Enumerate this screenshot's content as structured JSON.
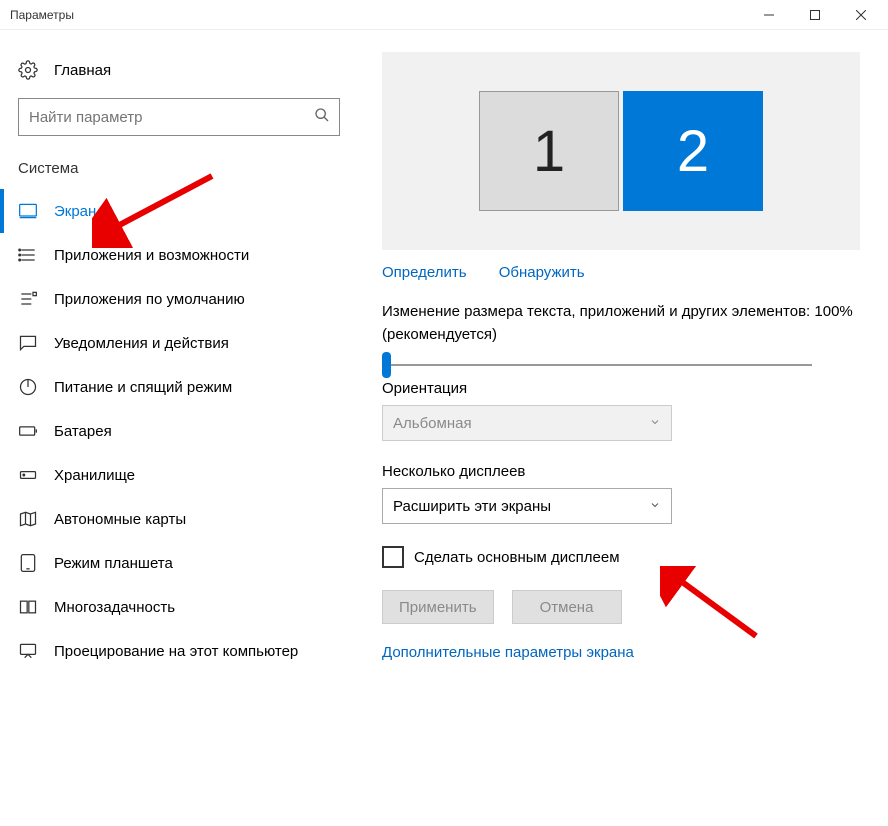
{
  "window": {
    "title": "Параметры"
  },
  "sidebar": {
    "home": "Главная",
    "search_placeholder": "Найти параметр",
    "section": "Система",
    "items": [
      {
        "label": "Экран"
      },
      {
        "label": "Приложения и возможности"
      },
      {
        "label": "Приложения по умолчанию"
      },
      {
        "label": "Уведомления и действия"
      },
      {
        "label": "Питание и спящий режим"
      },
      {
        "label": "Батарея"
      },
      {
        "label": "Хранилище"
      },
      {
        "label": "Автономные карты"
      },
      {
        "label": "Режим планшета"
      },
      {
        "label": "Многозадачность"
      },
      {
        "label": "Проецирование на этот компьютер"
      }
    ]
  },
  "content": {
    "monitor1": "1",
    "monitor2": "2",
    "identify": "Определить",
    "detect": "Обнаружить",
    "scale_text": "Изменение размера текста, приложений и других элементов: 100% (рекомендуется)",
    "orientation_label": "Ориентация",
    "orientation_value": "Альбомная",
    "multiple_label": "Несколько дисплеев",
    "multiple_value": "Расширить эти экраны",
    "make_main": "Сделать основным дисплеем",
    "apply": "Применить",
    "cancel": "Отмена",
    "advanced": "Дополнительные параметры экрана"
  }
}
